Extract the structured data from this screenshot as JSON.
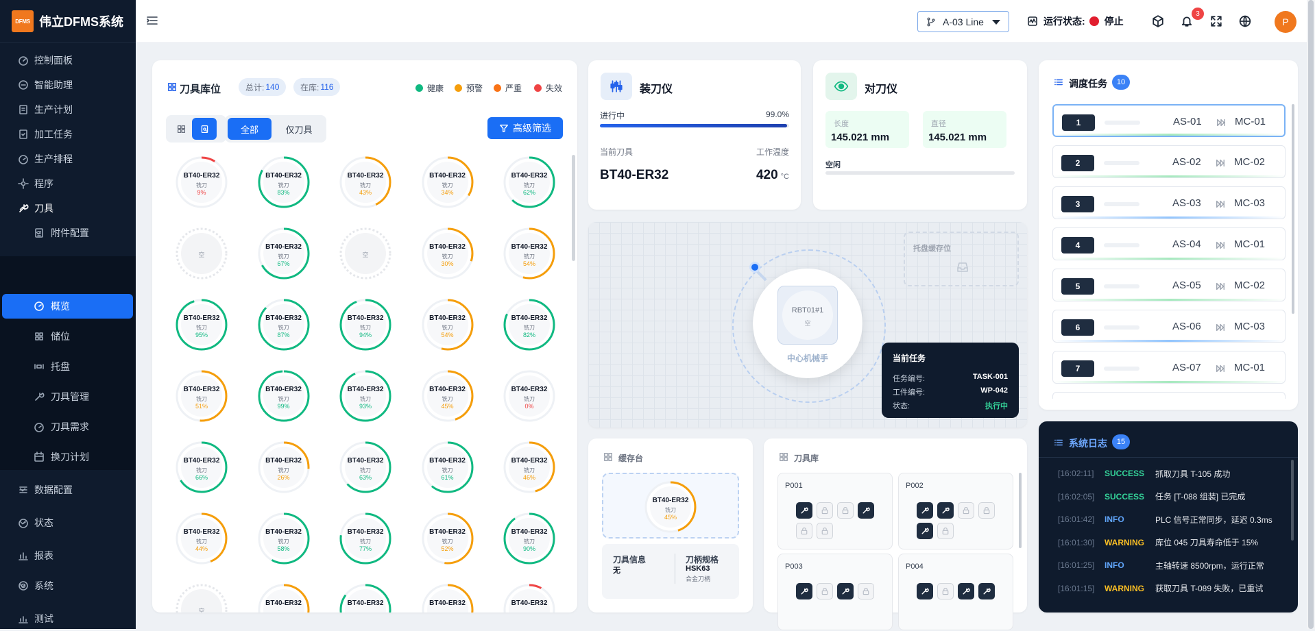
{
  "brand": {
    "logo_text": "DFMS",
    "name": "伟立DFMS系统"
  },
  "nav": {
    "items": [
      {
        "label": "控制面板",
        "icon": "dashboard-icon"
      },
      {
        "label": "智能助理",
        "icon": "assistant-icon"
      },
      {
        "label": "生产计划",
        "icon": "plan-icon"
      },
      {
        "label": "加工任务",
        "icon": "task-icon"
      },
      {
        "label": "生产排程",
        "icon": "schedule-icon"
      },
      {
        "label": "程序",
        "icon": "program-icon"
      }
    ],
    "tool": {
      "label": "刀具",
      "icon": "tool-icon"
    },
    "sub": {
      "label": "附件配置"
    },
    "active": {
      "label": "概览"
    },
    "subitems": [
      {
        "label": "储位"
      },
      {
        "label": "托盘"
      },
      {
        "label": "刀具管理"
      },
      {
        "label": "刀具需求"
      },
      {
        "label": "换刀计划"
      }
    ],
    "bottom": [
      {
        "label": "数据配置"
      },
      {
        "label": "状态"
      },
      {
        "label": "报表"
      },
      {
        "label": "系统"
      },
      {
        "label": "测试"
      }
    ]
  },
  "topbar": {
    "line": "A-03 Line",
    "run_label": "运行状态:",
    "run_value": "停止",
    "bell_count": "3",
    "avatar": "P"
  },
  "magazine": {
    "title": "刀具库位",
    "total_label": "总计:",
    "total": "140",
    "inuse_label": "在库:",
    "inuse": "116",
    "legend": [
      {
        "label": "健康",
        "color": "#10b981"
      },
      {
        "label": "预警",
        "color": "#f59e0b"
      },
      {
        "label": "严重",
        "color": "#f97316"
      },
      {
        "label": "失效",
        "color": "#ef4444"
      }
    ],
    "filter_all": "全部",
    "filter_tool": "仅刀具",
    "advanced": "高级筛选",
    "empty_label": "空",
    "slots": [
      {
        "n": "BT40-ER32",
        "t": "铣刀",
        "p": 9
      },
      {
        "n": "BT40-ER32",
        "t": "铣刀",
        "p": 83
      },
      {
        "n": "BT40-ER32",
        "t": "铣刀",
        "p": 43
      },
      {
        "n": "BT40-ER32",
        "t": "铣刀",
        "p": 34
      },
      {
        "n": "BT40-ER32",
        "t": "铣刀",
        "p": 62
      },
      {
        "empty": true
      },
      {
        "n": "BT40-ER32",
        "t": "铣刀",
        "p": 67
      },
      {
        "empty": true
      },
      {
        "n": "BT40-ER32",
        "t": "铣刀",
        "p": 30
      },
      {
        "n": "BT40-ER32",
        "t": "铣刀",
        "p": 54
      },
      {
        "n": "BT40-ER32",
        "t": "铣刀",
        "p": 95
      },
      {
        "n": "BT40-ER32",
        "t": "铣刀",
        "p": 87
      },
      {
        "n": "BT40-ER32",
        "t": "铣刀",
        "p": 94
      },
      {
        "n": "BT40-ER32",
        "t": "铣刀",
        "p": 54
      },
      {
        "n": "BT40-ER32",
        "t": "铣刀",
        "p": 82
      },
      {
        "n": "BT40-ER32",
        "t": "铣刀",
        "p": 51
      },
      {
        "n": "BT40-ER32",
        "t": "铣刀",
        "p": 99
      },
      {
        "n": "BT40-ER32",
        "t": "铣刀",
        "p": 93
      },
      {
        "n": "BT40-ER32",
        "t": "铣刀",
        "p": 45
      },
      {
        "n": "BT40-ER32",
        "t": "铣刀",
        "p": 0
      },
      {
        "n": "BT40-ER32",
        "t": "铣刀",
        "p": 66
      },
      {
        "n": "BT40-ER32",
        "t": "铣刀",
        "p": 26
      },
      {
        "n": "BT40-ER32",
        "t": "铣刀",
        "p": 63
      },
      {
        "n": "BT40-ER32",
        "t": "铣刀",
        "p": 61
      },
      {
        "n": "BT40-ER32",
        "t": "铣刀",
        "p": 46
      },
      {
        "n": "BT40-ER32",
        "t": "铣刀",
        "p": 44
      },
      {
        "n": "BT40-ER32",
        "t": "铣刀",
        "p": 58
      },
      {
        "n": "BT40-ER32",
        "t": "铣刀",
        "p": 77
      },
      {
        "n": "BT40-ER32",
        "t": "铣刀",
        "p": 52
      },
      {
        "n": "BT40-ER32",
        "t": "铣刀",
        "p": 90
      },
      {
        "empty": true
      },
      {
        "n": "BT40-ER32",
        "t": "",
        "p": 50
      },
      {
        "n": "BT40-ER32",
        "t": "",
        "p": 85
      },
      {
        "n": "BT40-ER32",
        "t": "",
        "p": 40
      },
      {
        "n": "BT40-ER32",
        "t": "",
        "p": 8
      }
    ]
  },
  "loader": {
    "title": "装刀仪",
    "progress_label": "进行中",
    "progress_value": "99.0%",
    "progress": 0.99,
    "current_tool_label": "当前刀具",
    "current_tool": "BT40-ER32",
    "temp_label": "工作温度",
    "temp": "420",
    "temp_unit": "°C"
  },
  "setter": {
    "title": "对刀仪",
    "length_label": "长度",
    "length": "145.021 mm",
    "diameter_label": "直径",
    "diameter": "145.021 mm",
    "state": "空闲"
  },
  "arena": {
    "robot_id": "RBT01#1",
    "robot_state": "空",
    "robot_label": "中心机械手",
    "buffer_label": "托盘缓存位",
    "task": {
      "title": "当前任务",
      "no_label": "任务编号:",
      "no": "TASK-001",
      "wp_label": "工件编号:",
      "wp": "WP-042",
      "st_label": "状态:",
      "st": "执行中"
    }
  },
  "cache": {
    "title": "缓存台",
    "tool": {
      "n": "BT40-ER32",
      "t": "铣刀",
      "p": 45
    },
    "info_label": "刀具信息",
    "info_value": "无",
    "spec_label": "刀柄规格",
    "spec_value": "HSK63",
    "spec_sub": "合金刀柄"
  },
  "library": {
    "title": "刀具库",
    "pallets": [
      {
        "name": "P001",
        "cells": [
          1,
          0,
          0,
          1,
          0,
          0
        ]
      },
      {
        "name": "P002",
        "cells": [
          1,
          1,
          0,
          0,
          1,
          0
        ]
      },
      {
        "name": "P003",
        "cells": [
          1,
          0,
          1,
          0
        ]
      },
      {
        "name": "P004",
        "cells": [
          1,
          0,
          1,
          1
        ]
      }
    ]
  },
  "schedule": {
    "title": "调度任务",
    "count": "10",
    "tasks": [
      {
        "no": "1",
        "from": "AS-01",
        "to": "MC-01"
      },
      {
        "no": "2",
        "from": "AS-02",
        "to": "MC-02"
      },
      {
        "no": "3",
        "from": "AS-03",
        "to": "MC-03"
      },
      {
        "no": "4",
        "from": "AS-04",
        "to": "MC-01"
      },
      {
        "no": "5",
        "from": "AS-05",
        "to": "MC-02"
      },
      {
        "no": "6",
        "from": "AS-06",
        "to": "MC-03"
      },
      {
        "no": "7",
        "from": "AS-07",
        "to": "MC-01"
      }
    ]
  },
  "log": {
    "title": "系统日志",
    "count": "15",
    "entries": [
      {
        "ts": "[16:02:11]",
        "lv": "SUCCESS",
        "msg": "抓取刀具 T-105 成功",
        "color": "#34d399"
      },
      {
        "ts": "[16:02:05]",
        "lv": "SUCCESS",
        "msg": "任务 [T-088 组装] 已完成",
        "color": "#34d399"
      },
      {
        "ts": "[16:01:42]",
        "lv": "INFO",
        "msg": "PLC 信号正常同步，延迟 0.3ms",
        "color": "#60a5fa"
      },
      {
        "ts": "[16:01:30]",
        "lv": "WARNING",
        "msg": "库位 045 刀具寿命低于 15%",
        "color": "#fbbf24"
      },
      {
        "ts": "[16:01:25]",
        "lv": "INFO",
        "msg": "主轴转速 8500rpm，运行正常",
        "color": "#60a5fa"
      },
      {
        "ts": "[16:01:15]",
        "lv": "WARNING",
        "msg": "获取刀具 T-089 失败，已重试",
        "color": "#fbbf24"
      }
    ]
  }
}
